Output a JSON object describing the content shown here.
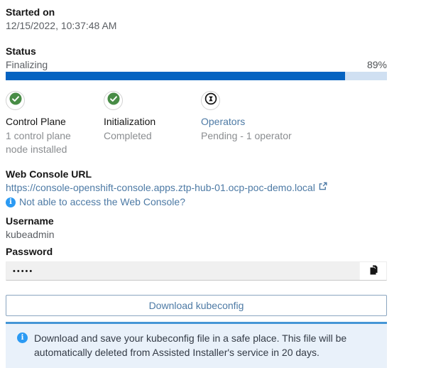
{
  "started_on": {
    "label": "Started on",
    "value": "12/15/2022, 10:37:48 AM"
  },
  "status": {
    "label": "Status",
    "value": "Finalizing",
    "percent_label": "89%",
    "progress": 89
  },
  "steps": [
    {
      "title": "Control Plane",
      "subtitle": "1 control plane node installed",
      "state": "success"
    },
    {
      "title": "Initialization",
      "subtitle": "Completed",
      "state": "success"
    },
    {
      "title": "Operators",
      "subtitle": "Pending - 1 operator",
      "state": "pending"
    }
  ],
  "web_console": {
    "label": "Web Console URL",
    "url": "https://console-openshift-console.apps.ztp-hub-01.ocp-poc-demo.local",
    "help_link": "Not able to access the Web Console?"
  },
  "username": {
    "label": "Username",
    "value": "kubeadmin"
  },
  "password": {
    "label": "Password",
    "masked_value": "•••••"
  },
  "download_button_label": "Download kubeconfig",
  "alert": {
    "text": "Download and save your kubeconfig file in a safe place. This file will be automatically deleted from Assisted Installer's service in 20 days."
  },
  "icons": {
    "success": "check-circle-icon",
    "pending": "pending-hourglass-icon",
    "external": "external-link-icon",
    "info": "info-icon",
    "copy": "copy-icon"
  },
  "colors": {
    "progress_fill": "#0563c1",
    "progress_track": "#d0e0f2",
    "success_green": "#488c46",
    "link_blue": "#4d7aa5",
    "info_blue": "#2b9af3",
    "alert_bg": "#e9f1fa"
  }
}
